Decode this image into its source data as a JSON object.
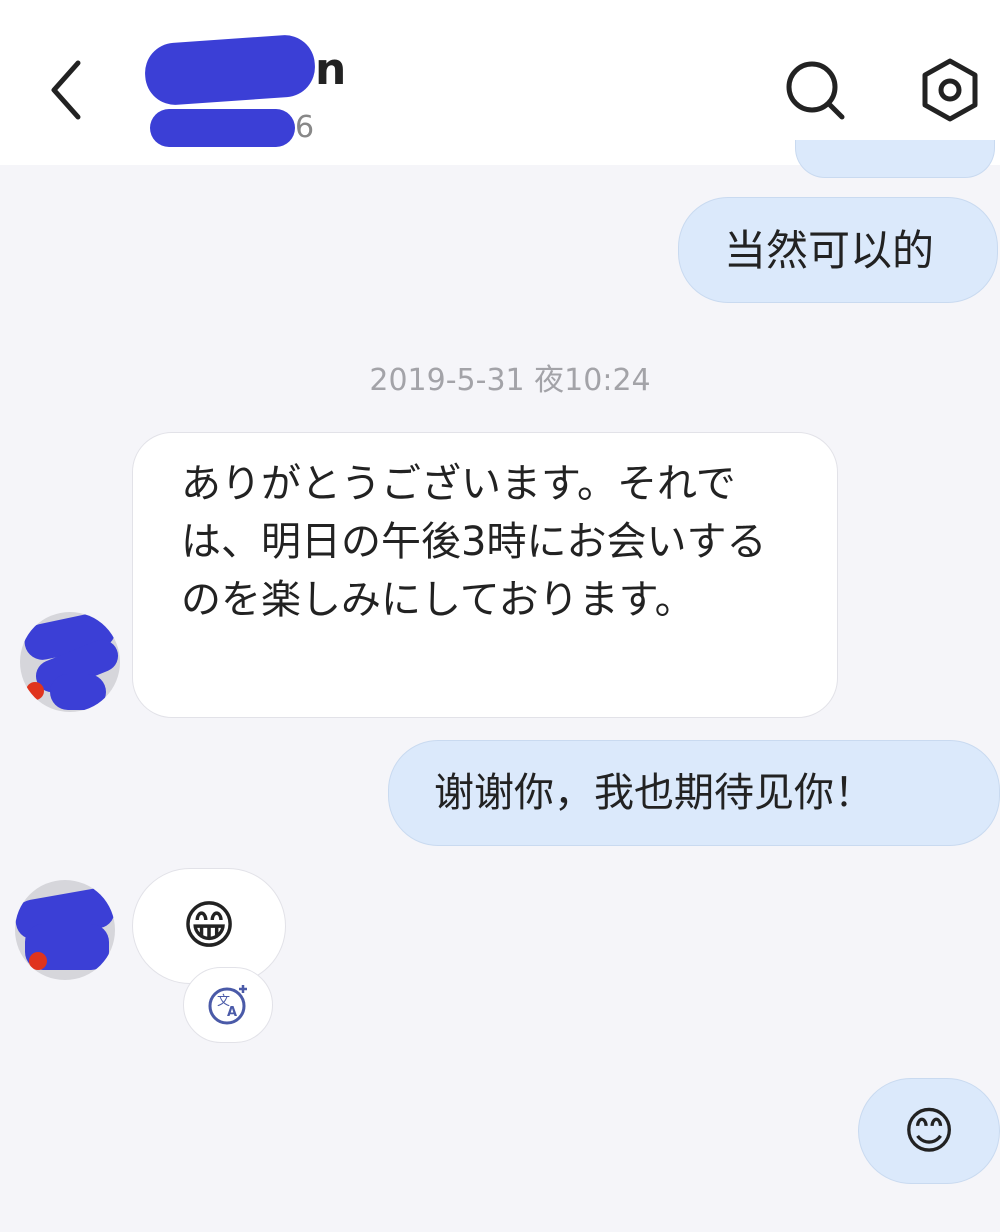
{
  "header": {
    "contact_name_visible": "n",
    "contact_sub_visible": "6",
    "back_icon": "chevron-left-icon",
    "search_icon": "search-icon",
    "settings_icon": "hexagon-gear-icon"
  },
  "messages": [
    {
      "side": "sent",
      "text": "当然可以的"
    },
    {
      "side": "received",
      "text": "ありがとうございます。それでは、明日の午後3時にお会いするのを楽しみにしております。"
    },
    {
      "side": "sent",
      "text": "谢谢你，我也期待见你！"
    },
    {
      "side": "received",
      "text": "😁"
    },
    {
      "side": "sent",
      "text": "😊"
    }
  ],
  "timestamp": "2019-5-31 夜10:24",
  "translate_icon": "translate-icon",
  "colors": {
    "sent_bubble": "#dbe9fb",
    "received_bubble": "#ffffff",
    "background": "#f5f5f9",
    "redaction": "#3b3fd6"
  }
}
